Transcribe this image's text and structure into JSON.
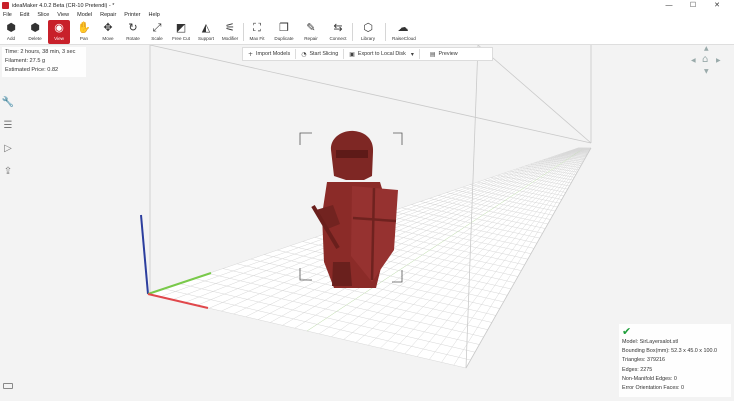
{
  "window": {
    "title": "ideaMaker 4.0.2 Beta (CR-10 Pretendi) - *",
    "minimize": "—",
    "maximize": "☐",
    "close": "✕"
  },
  "menu": [
    "File",
    "Edit",
    "Slice",
    "View",
    "Model",
    "Repair",
    "Printer",
    "Help"
  ],
  "toolbar": [
    {
      "label": "Add",
      "icon": "add-icon",
      "glyph": "⬢"
    },
    {
      "label": "Delete",
      "icon": "delete-icon",
      "glyph": "⬢"
    },
    {
      "label": "View",
      "icon": "eye-icon",
      "glyph": "◉",
      "active": true
    },
    {
      "label": "Pan",
      "icon": "hand-icon",
      "glyph": "✋"
    },
    {
      "label": "Move",
      "icon": "move-icon",
      "glyph": "✥"
    },
    {
      "label": "Rotate",
      "icon": "rotate-icon",
      "glyph": "↻"
    },
    {
      "label": "Scale",
      "icon": "scale-icon",
      "glyph": "⤢"
    },
    {
      "label": "Free Cut",
      "icon": "cut-icon",
      "glyph": "◩"
    },
    {
      "label": "Support",
      "icon": "support-icon",
      "glyph": "◭"
    },
    {
      "label": "Modifier",
      "icon": "modifier-icon",
      "glyph": "⚟"
    },
    {
      "label": "Max Fit",
      "icon": "max-fit-icon",
      "glyph": "⛶"
    },
    {
      "label": "Duplicate",
      "icon": "duplicate-icon",
      "glyph": "❐"
    },
    {
      "label": "Repair",
      "icon": "wrench-icon",
      "glyph": "✎"
    },
    {
      "label": "Connect",
      "icon": "connect-icon",
      "glyph": "⇆"
    },
    {
      "label": "Library",
      "icon": "library-icon",
      "glyph": "⬡"
    },
    {
      "label": "RaiseCloud",
      "icon": "cloud-icon",
      "glyph": "☁"
    }
  ],
  "print_info": {
    "time": "Time: 2 hours, 38 min, 3 sec",
    "filament": "Filament: 27.5 g",
    "price": "Estimated Price: 0.82"
  },
  "actions": {
    "import": "Import Models",
    "start": "Start Slicing",
    "export": "Export to Local Disk",
    "preview": "Preview"
  },
  "model_info": {
    "name": "Model: SirLayersalot.stl",
    "bbox": "Bounding Box(mm): 52.3 x 45.0 x 100.0",
    "triangles": "Triangles: 379216",
    "edges": "Edges: 2275",
    "non_manifold": "Non-Manifold Edges: 0",
    "error_faces": "Error Orientation Faces: 0"
  },
  "colors": {
    "accent": "#c8202a",
    "model": "#8b2b28",
    "ok": "#1e9e3a"
  }
}
